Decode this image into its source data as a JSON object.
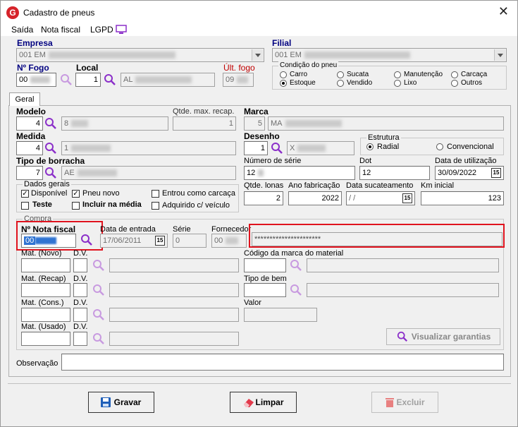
{
  "window": {
    "title": "Cadastro de pneus",
    "app_icon": "G"
  },
  "menu": {
    "saida": "Saída",
    "nota_fiscal": "Nota fiscal",
    "lgpd": "LGPD"
  },
  "header": {
    "empresa_label": "Empresa",
    "empresa_value": "001 EM",
    "filial_label": "Filial",
    "filial_value": "001 EM",
    "fogo_label": "Nº Fogo",
    "fogo_value": "00",
    "local_label": "Local",
    "local_value": "1",
    "local_desc": "AL",
    "ult_fogo_label": "Últ. fogo",
    "ult_fogo_value": "09"
  },
  "condicao": {
    "title": "Condição do pneu",
    "options": [
      "Carro",
      "Sucata",
      "Manutenção",
      "Carcaça",
      "Estoque",
      "Vendido",
      "Lixo",
      "Outros"
    ],
    "selected": "Estoque"
  },
  "tab": {
    "label": "Geral"
  },
  "geral": {
    "modelo_label": "Modelo",
    "modelo_value": "4",
    "modelo_desc": "8",
    "qtde_label": "Qtde. max. recap.",
    "qtde_value": "1",
    "marca_label": "Marca",
    "marca_value": "5",
    "marca_desc": "MA",
    "medida_label": "Medida",
    "medida_value": "4",
    "medida_desc": "1",
    "desenho_label": "Desenho",
    "desenho_value": "1",
    "desenho_desc": "X",
    "estrutura_title": "Estrutura",
    "estrutura_radial": "Radial",
    "estrutura_conv": "Convencional",
    "tipo_label": "Tipo de borracha",
    "tipo_value": "7",
    "tipo_desc": "AE",
    "serie_label": "Número de série",
    "serie_value": "12",
    "dot_label": "Dot",
    "dot_value": "12",
    "data_util_label": "Data de utilização",
    "data_util_value": "30/09/2022",
    "dados_title": "Dados gerais",
    "disponivel": "Disponível",
    "pneu_novo": "Pneu novo",
    "entrou_carcaca": "Entrou como carcaça",
    "teste": "Teste",
    "incluir_media": "Incluir na média",
    "adquirido": "Adquirido c/ veículo",
    "lonas_label": "Qtde. lonas",
    "lonas_value": "2",
    "ano_label": "Ano fabricação",
    "ano_value": "2022",
    "sucat_label": "Data sucateamento",
    "sucat_value": "/ /",
    "km_label": "Km inicial",
    "km_value": "123",
    "cal_icon_text": "15"
  },
  "compra": {
    "title": "Compra",
    "nf_label": "Nº Nota fiscal",
    "nf_value": "00",
    "data_entrada_label": "Data de entrada",
    "data_entrada_value": "17/06/2011",
    "serie_label": "Série",
    "serie_value": "0",
    "fornecedor_label": "Fornecedor",
    "fornecedor_code": "00",
    "fornecedor_name": "**********************",
    "mat_novo": "Mat. (Novo)",
    "mat_recap": "Mat. (Recap)",
    "mat_cons": "Mat. (Cons.)",
    "mat_usado": "Mat. (Usado)",
    "dv": "D.V.",
    "cod_marca_label": "Código da marca do material",
    "tipo_bem_label": "Tipo de bem",
    "valor_label": "Valor",
    "garantias_btn": "Visualizar garantias"
  },
  "observacao_label": "Observação",
  "buttons": {
    "gravar": "Gravar",
    "limpar": "Limpar",
    "excluir": "Excluir"
  },
  "colors": {
    "accent": "#8b2fc9",
    "highlight": "#e0131e",
    "label_blue": "#000080",
    "label_red": "#c00000"
  }
}
